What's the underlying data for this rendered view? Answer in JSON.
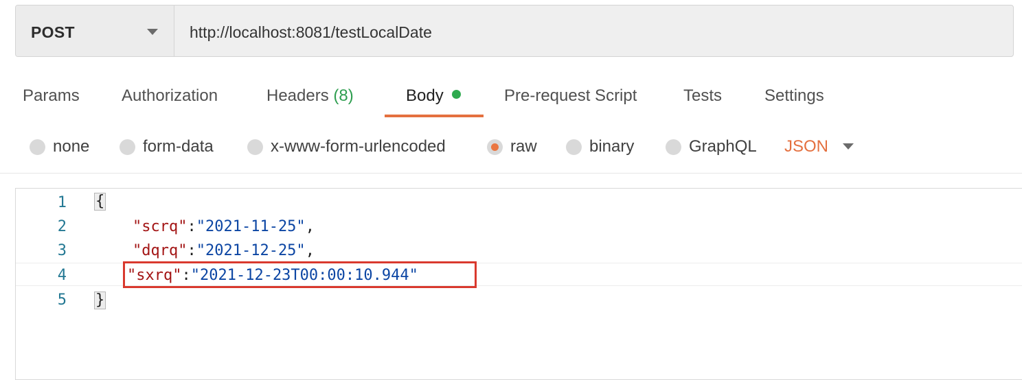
{
  "request": {
    "method": "POST",
    "url": "http://localhost:8081/testLocalDate"
  },
  "tabs": {
    "params": "Params",
    "authorization": "Authorization",
    "headers": "Headers",
    "headers_count": "(8)",
    "body": "Body",
    "pre_request": "Pre-request Script",
    "tests": "Tests",
    "settings": "Settings",
    "active": "Body"
  },
  "body_types": {
    "none": "none",
    "form_data": "form-data",
    "urlencoded": "x-www-form-urlencoded",
    "raw": "raw",
    "binary": "binary",
    "graphql": "GraphQL",
    "selected": "raw",
    "format": "JSON"
  },
  "editor": {
    "line_numbers": [
      "1",
      "2",
      "3",
      "4",
      "5"
    ],
    "open_brace": "{",
    "close_brace": "}",
    "entries": [
      {
        "key": "\"scrq\"",
        "value": "\"2021-11-25\"",
        "trail": ","
      },
      {
        "key": "\"dqrq\"",
        "value": "\"2021-12-25\"",
        "trail": ","
      },
      {
        "key": "\"sxrq\"",
        "value": "\"2021-12-23T00:00:10.944\"",
        "trail": ""
      }
    ],
    "colon": ":"
  },
  "colors": {
    "accent": "#e4703f",
    "highlight_border": "#d9392e",
    "key": "#a31515",
    "string": "#0b45a3",
    "status_dot": "#2eaa4f"
  }
}
